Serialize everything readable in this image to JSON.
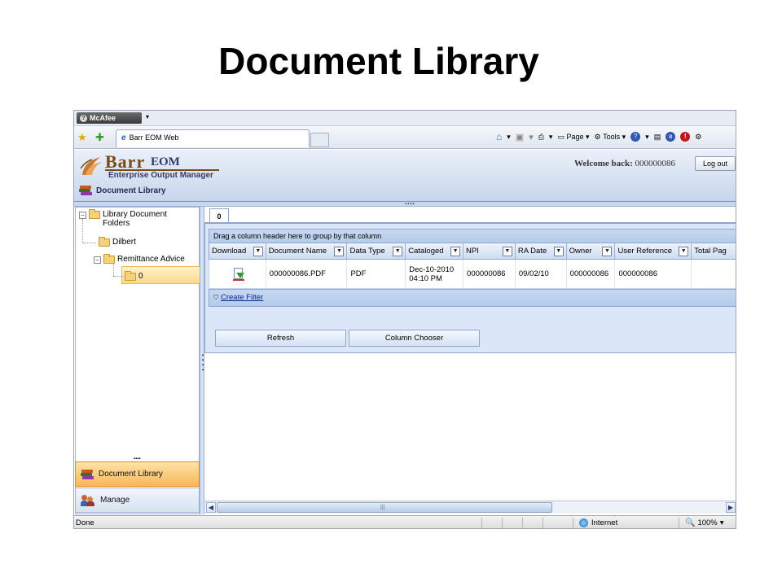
{
  "slide": {
    "title": "Document Library"
  },
  "mcafee": {
    "label": "McAfee"
  },
  "browser": {
    "tab_title": "Barr EOM Web",
    "tools": {
      "page": "Page",
      "tools": "Tools"
    }
  },
  "app": {
    "logo_barr": "Barr",
    "logo_eom": "EOM",
    "logo_sub": "Enterprise Output Manager",
    "welcome_label": "Welcome back:",
    "welcome_user": "000000086",
    "logout": "Log out",
    "crumb": "Document Library"
  },
  "tree": {
    "root": "Library Document Folders",
    "n1": "Dilbert",
    "n2": "Remittance Advice",
    "n3": "0"
  },
  "nav": {
    "doc_library": "Document Library",
    "manage": "Manage"
  },
  "content": {
    "tab": "0",
    "group_hint": "Drag a column header here to group by that column",
    "columns": [
      "Download",
      "Document Name",
      "Data Type",
      "Cataloged",
      "NPI",
      "RA Date",
      "Owner",
      "User Reference",
      "Total Pag"
    ],
    "row": {
      "document_name": "000000086.PDF",
      "data_type": "PDF",
      "cataloged_date": "Dec-10-2010",
      "cataloged_time": "04:10 PM",
      "npi": "000000086",
      "ra_date": "09/02/10",
      "owner": "000000086",
      "user_reference": "000000086"
    },
    "create_filter": "Create Filter",
    "refresh": "Refresh",
    "column_chooser": "Column Chooser"
  },
  "status": {
    "done": "Done",
    "zone": "Internet",
    "zoom": "100%"
  }
}
